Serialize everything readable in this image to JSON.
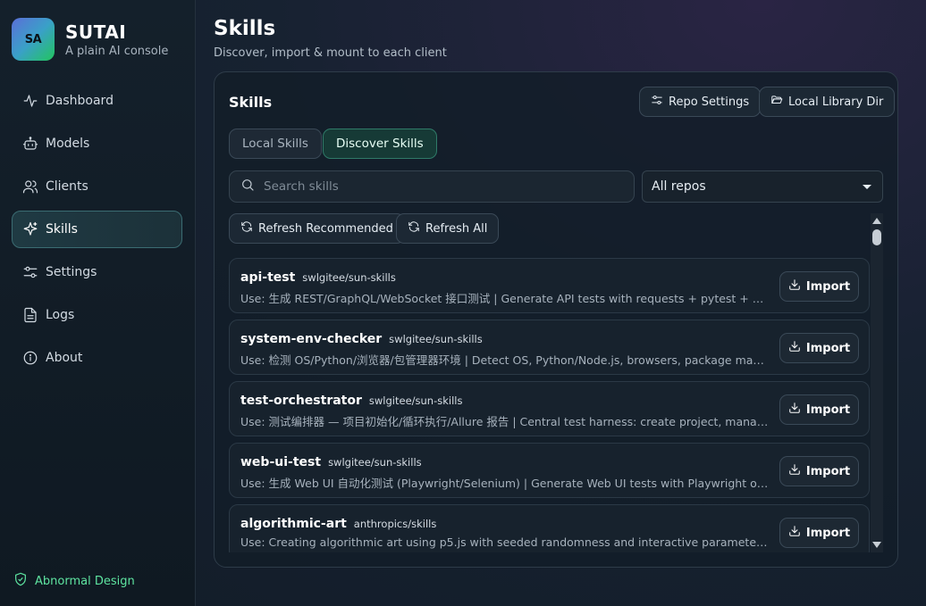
{
  "brand": {
    "logo_text": "SA",
    "name": "SUTAI",
    "subtitle": "A plain AI console"
  },
  "sidebar": {
    "items": [
      {
        "label": "Dashboard",
        "icon": "activity-icon",
        "active": false
      },
      {
        "label": "Models",
        "icon": "bot-icon",
        "active": false
      },
      {
        "label": "Clients",
        "icon": "users-icon",
        "active": false
      },
      {
        "label": "Skills",
        "icon": "sparkles-icon",
        "active": true
      },
      {
        "label": "Settings",
        "icon": "sliders-icon",
        "active": false
      },
      {
        "label": "Logs",
        "icon": "file-text-icon",
        "active": false
      },
      {
        "label": "About",
        "icon": "info-icon",
        "active": false
      }
    ],
    "status": {
      "label": "Abnormal Design",
      "icon": "shield-check-icon",
      "color": "#5ee4a0"
    }
  },
  "page": {
    "title": "Skills",
    "subtitle": "Discover, import & mount to each client"
  },
  "card": {
    "title": "Skills",
    "repo_settings_label": "Repo Settings",
    "local_library_label": "Local Library Dir",
    "tabs": [
      {
        "label": "Local Skills",
        "active": false
      },
      {
        "label": "Discover Skills",
        "active": true
      }
    ],
    "search": {
      "placeholder": "Search skills",
      "value": ""
    },
    "repo_filter": {
      "selected": "All repos"
    },
    "refresh_recommended_label": "Refresh Recommended",
    "refresh_all_label": "Refresh All"
  },
  "skills": [
    {
      "name": "api-test",
      "repo": "swlgitee/sun-skills",
      "desc": "Use: 生成 REST/GraphQL/WebSocket 接口测试 | Generate API tests with requests + pytest + data-driv...",
      "action": "Import"
    },
    {
      "name": "system-env-checker",
      "repo": "swlgitee/sun-skills",
      "desc": "Use: 检测 OS/Python/浏览器/包管理器环境 | Detect OS, Python/Node.js, browsers, package managers; ...",
      "action": "Import"
    },
    {
      "name": "test-orchestrator",
      "repo": "swlgitee/sun-skills",
      "desc": "Use: 测试编排器 — 项目初始化/循环执行/Allure 报告 | Central test harness: create project, manage exec...",
      "action": "Import"
    },
    {
      "name": "web-ui-test",
      "repo": "swlgitee/sun-skills",
      "desc": "Use: 生成 Web UI 自动化测试 (Playwright/Selenium) | Generate Web UI tests with Playwright or Seleni...",
      "action": "Import"
    },
    {
      "name": "algorithmic-art",
      "repo": "anthropics/skills",
      "desc": "Use: Creating algorithmic art using p5.js with seeded randomness and interactive parameter explorati...",
      "action": "Import"
    }
  ],
  "colors": {
    "accent": "#2f7a68",
    "active_nav_border": "#3b6c72",
    "status_green": "#5ee4a0"
  }
}
